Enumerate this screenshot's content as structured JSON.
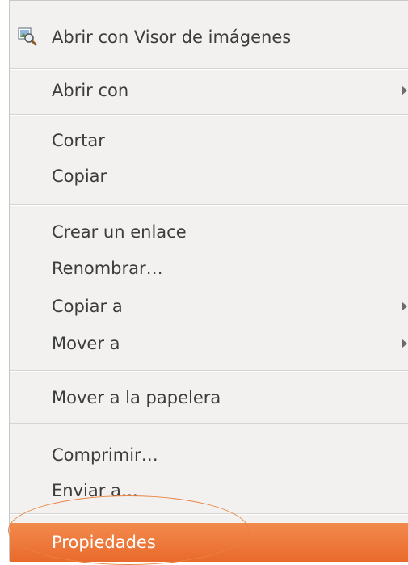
{
  "menu": {
    "open_with_viewer": {
      "label": "Abrir con Visor de imágenes",
      "icon": "image-viewer-icon"
    },
    "open_with": {
      "label": "Abrir con"
    },
    "cut": {
      "label": "Cortar"
    },
    "copy": {
      "label": "Copiar"
    },
    "create_link": {
      "label": "Crear un enlace"
    },
    "rename": {
      "label": "Renombrar…"
    },
    "copy_to": {
      "label": "Copiar a"
    },
    "move_to": {
      "label": "Mover a"
    },
    "move_to_trash": {
      "label": "Mover a la papelera"
    },
    "compress": {
      "label": "Comprimir…"
    },
    "send_to": {
      "label": "Enviar a…"
    },
    "properties": {
      "label": "Propiedades"
    }
  },
  "colors": {
    "highlight": "#e96a2b",
    "annotation_circle": "#e9823d",
    "menu_background": "#f2f1f0"
  }
}
